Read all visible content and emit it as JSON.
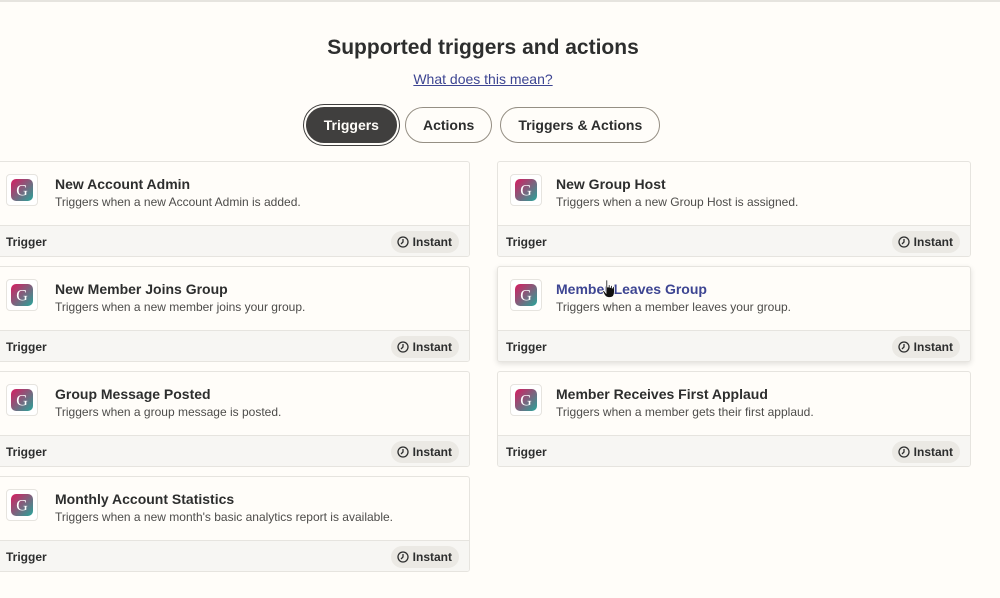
{
  "heading": "Supported triggers and actions",
  "help_link": "What does this mean?",
  "tabs": [
    {
      "label": "Triggers",
      "active": true
    },
    {
      "label": "Actions",
      "active": false
    },
    {
      "label": "Triggers & Actions",
      "active": false
    }
  ],
  "cards": [
    {
      "title": "New Account Admin",
      "desc": "Triggers when a new Account Admin is added.",
      "type": "Trigger",
      "badge": "Instant"
    },
    {
      "title": "New Group Host",
      "desc": "Triggers when a new Group Host is assigned.",
      "type": "Trigger",
      "badge": "Instant"
    },
    {
      "title": "New Member Joins Group",
      "desc": "Triggers when a new member joins your group.",
      "type": "Trigger",
      "badge": "Instant"
    },
    {
      "title": "Member Leaves Group",
      "desc": "Triggers when a member leaves your group.",
      "type": "Trigger",
      "badge": "Instant"
    },
    {
      "title": "Group Message Posted",
      "desc": "Triggers when a group message is posted.",
      "type": "Trigger",
      "badge": "Instant"
    },
    {
      "title": "Member Receives First Applaud",
      "desc": "Triggers when a member gets their first applaud.",
      "type": "Trigger",
      "badge": "Instant"
    },
    {
      "title": "Monthly Account Statistics",
      "desc": "Triggers when a new month's basic analytics report is available.",
      "type": "Trigger",
      "badge": "Instant"
    }
  ],
  "app_icon": {
    "name": "app-logo-icon",
    "letter": "G",
    "gradient_start": "#d81b60",
    "gradient_end": "#26a69a"
  }
}
